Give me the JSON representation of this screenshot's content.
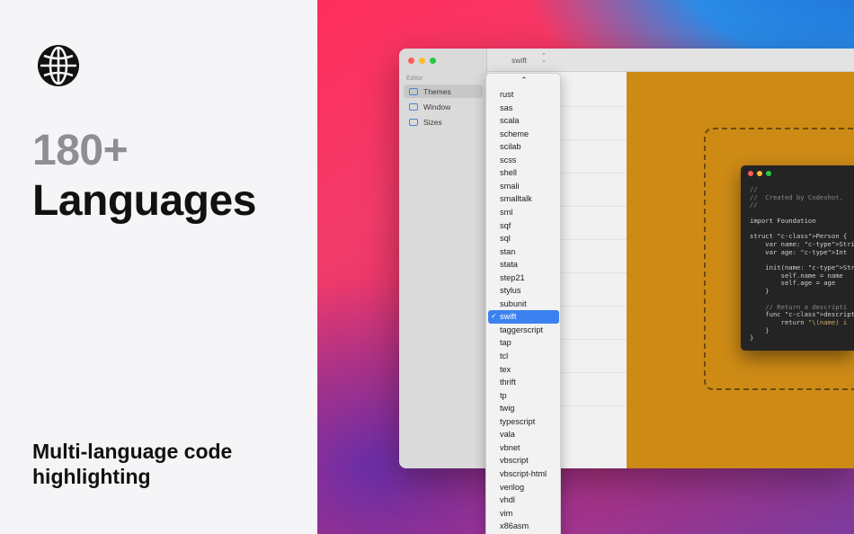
{
  "hero": {
    "count": "180+",
    "headline": "Languages",
    "tagline": "Multi-language code highlighting",
    "icon": "globe-icon"
  },
  "window": {
    "sidebar": {
      "heading": "Editor",
      "items": [
        {
          "label": "Themes",
          "selected": true
        },
        {
          "label": "Window",
          "selected": false
        },
        {
          "label": "Sizes",
          "selected": false
        }
      ]
    },
    "language_select": {
      "value": "swift"
    }
  },
  "menu": {
    "selected": "swift",
    "items": [
      "rust",
      "sas",
      "scala",
      "scheme",
      "scilab",
      "scss",
      "shell",
      "smali",
      "smalltalk",
      "sml",
      "sqf",
      "sql",
      "stan",
      "stata",
      "step21",
      "stylus",
      "subunit",
      "swift",
      "taggerscript",
      "tap",
      "tcl",
      "tex",
      "thrift",
      "tp",
      "twig",
      "typescript",
      "vala",
      "vbnet",
      "vbscript",
      "vbscript-html",
      "verilog",
      "vhdl",
      "vim",
      "x86asm"
    ]
  },
  "code": {
    "lines": [
      "//",
      "//  Created by Codeshot.",
      "//",
      "",
      "import Foundation",
      "",
      "struct Person {",
      "    var name: String",
      "    var age: Int",
      "",
      "    init(name: String, age",
      "        self.name = name",
      "        self.age = age",
      "    }",
      "",
      "    // Return a descripti",
      "    func description(offs",
      "        return \"\\(name) i",
      "    }",
      "}"
    ]
  },
  "colors": {
    "preview_bg": "#cd8b16",
    "selection": "#3b82f0",
    "code_bg": "#242424"
  }
}
